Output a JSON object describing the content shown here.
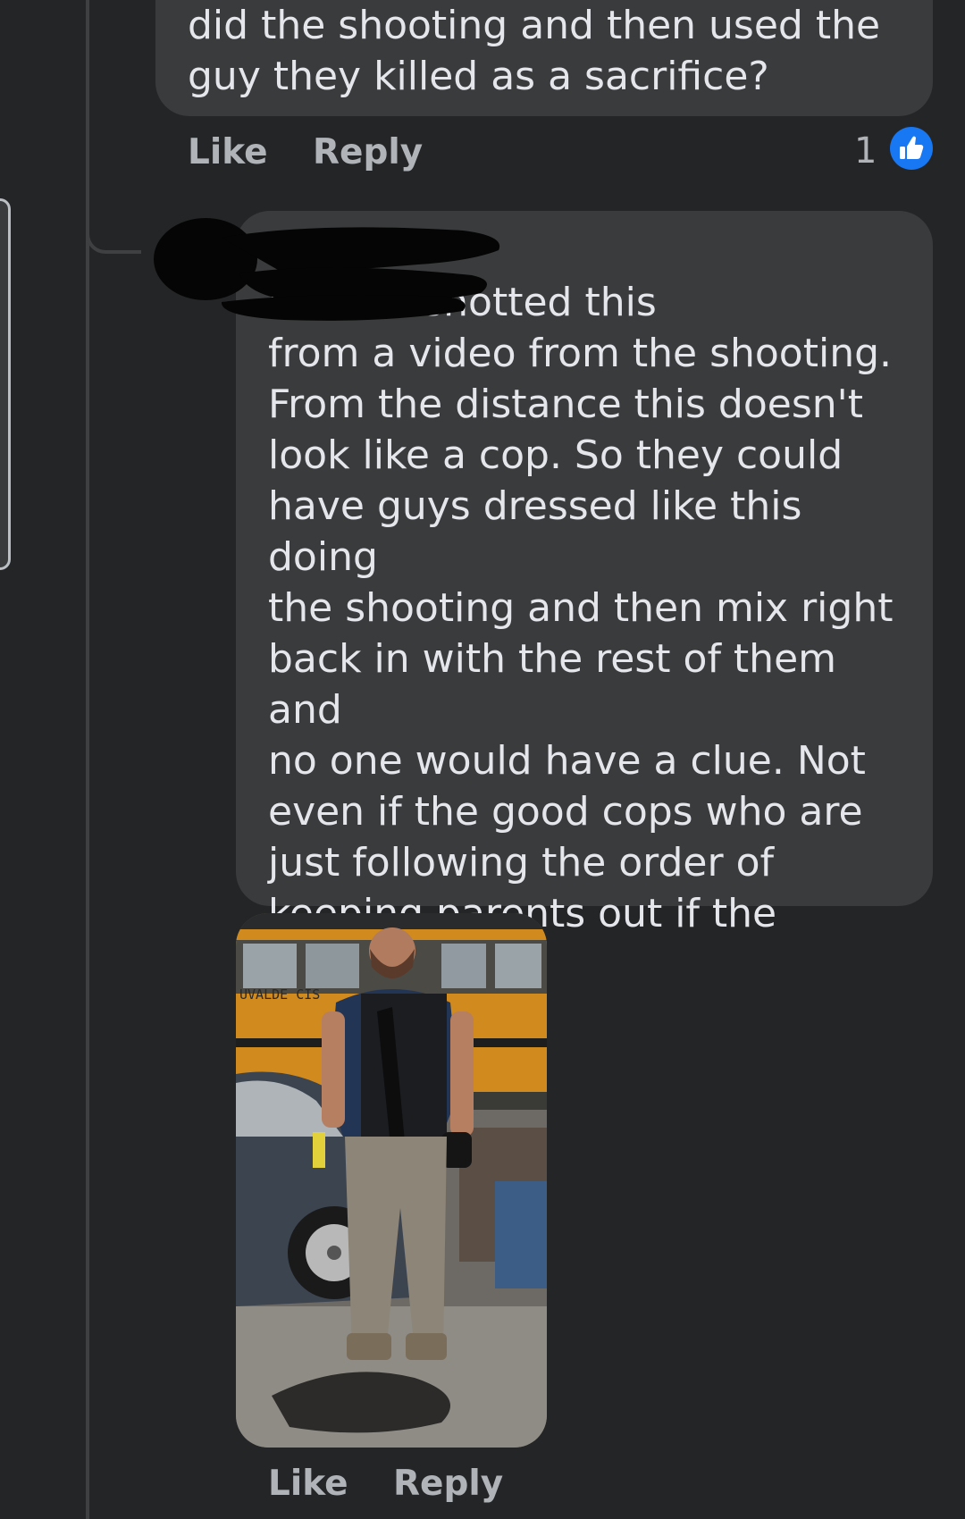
{
  "comments": [
    {
      "text": "did the shooting and then used the\nguy they killed as a sacrifice?",
      "actions": {
        "like_label": "Like",
        "reply_label": "Reply"
      },
      "reaction_count": "1"
    },
    {
      "text": "I screenshotted this\nfrom a video from the shooting.\nFrom the distance this doesn't\nlook like a cop. So they could\nhave guys dressed like this doing\nthe shooting and then mix right\nback in with the rest of them and\nno one would have a clue. Not\neven if the good cops who are\njust following the order of\nkeeping parents out if the school\nlike a robot.",
      "photo_sign_text": "UVALDE CIS",
      "actions": {
        "like_label": "Like",
        "reply_label": "Reply"
      }
    }
  ],
  "colors": {
    "background": "#242526",
    "bubble": "#3a3b3c",
    "like_blue": "#1877f2"
  },
  "icons": {
    "reaction": "like-thumbs-up-icon"
  }
}
